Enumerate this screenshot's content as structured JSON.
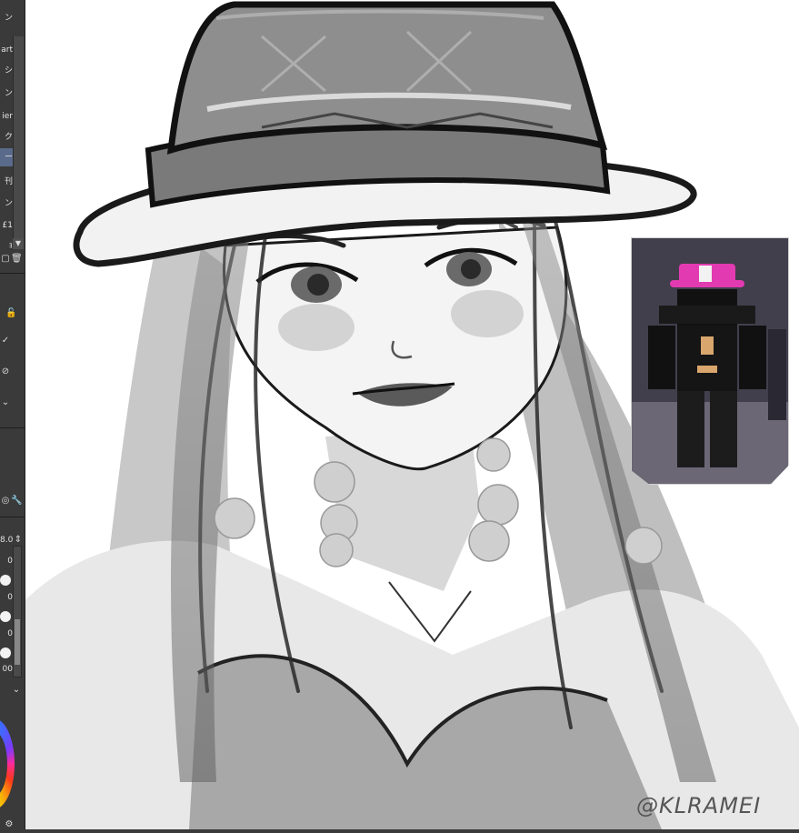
{
  "left_panel": {
    "rows": [
      {
        "label": "ン",
        "selected": false
      },
      {
        "label": "art",
        "selected": false
      },
      {
        "label": "シ",
        "selected": false
      },
      {
        "label": "ン",
        "selected": false
      },
      {
        "label": "ier",
        "selected": false
      },
      {
        "label": "ク",
        "selected": false
      },
      {
        "label": "ー",
        "selected": true
      },
      {
        "label": "刊",
        "selected": false
      },
      {
        "label": "ン",
        "selected": false
      },
      {
        "label": "£1",
        "selected": false
      },
      {
        "label": "ｮ",
        "selected": false
      }
    ],
    "size_value": "8.0",
    "value_labels": [
      "0",
      "0",
      "0",
      "00"
    ]
  },
  "watermark": "@KLRAMEI",
  "colors": {
    "panel_bg": "#3a3a3a",
    "canvas_bg": "#ffffff",
    "selected_row": "#5a6a8a",
    "hat_accent_reference": "#e23ab0"
  }
}
